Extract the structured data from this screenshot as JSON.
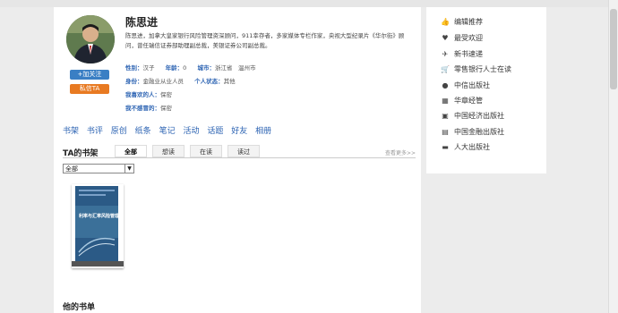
{
  "profile": {
    "name": "陈思进",
    "bio": "陈思进，加拿大皇家银行风险管理资深顾问，911幸存者，多家媒体专栏作家，央视大型纪录片《华尔街》顾问，曾任瑞信证券部助理副总裁，美银证券公司副总裁。",
    "follow_button": "+加关注",
    "message_button": "私信TA",
    "gender_label": "性别：",
    "gender": "汉子",
    "age_label": "年龄：",
    "age": "0",
    "city_label": "城市：",
    "city": "浙江省　温州市",
    "identity_label": "身份：",
    "identity": "金融业从业人员",
    "status_label": "个人状态：",
    "status": "其他",
    "fav_people_label": "我喜欢的人：",
    "fav_people": "保密",
    "disliked_label": "我不感冒的：",
    "disliked": "保密"
  },
  "nav": [
    "书架",
    "书评",
    "原创",
    "纸条",
    "笔记",
    "活动",
    "话题",
    "好友",
    "相册"
  ],
  "shelf": {
    "title": "TA的书架",
    "tabs": [
      "全部",
      "想读",
      "在读",
      "读过"
    ],
    "more": "查看更多>>",
    "select_value": "全部"
  },
  "book": {
    "cover_title": "利率与汇率风险管理"
  },
  "booklist_title": "他的书单",
  "sidebar": {
    "items": [
      {
        "label": "编辑推荐",
        "icon": "thumbs-up-icon",
        "glyph": "👍"
      },
      {
        "label": "最受欢迎",
        "icon": "heart-icon",
        "glyph": "♥"
      },
      {
        "label": "新书速递",
        "icon": "plane-icon",
        "glyph": "✈"
      },
      {
        "label": "零售银行人士在读",
        "icon": "cart-icon",
        "glyph": "🛒"
      },
      {
        "label": "中信出版社",
        "icon": "globe-icon",
        "glyph": "●"
      },
      {
        "label": "华章经管",
        "icon": "newspaper-icon",
        "glyph": "▦"
      },
      {
        "label": "中国经济出版社",
        "icon": "book-icon",
        "glyph": "▣"
      },
      {
        "label": "中国金融出版社",
        "icon": "money-icon",
        "glyph": "▤"
      },
      {
        "label": "人大出版社",
        "icon": "bank-card-icon",
        "glyph": "▬"
      }
    ]
  }
}
